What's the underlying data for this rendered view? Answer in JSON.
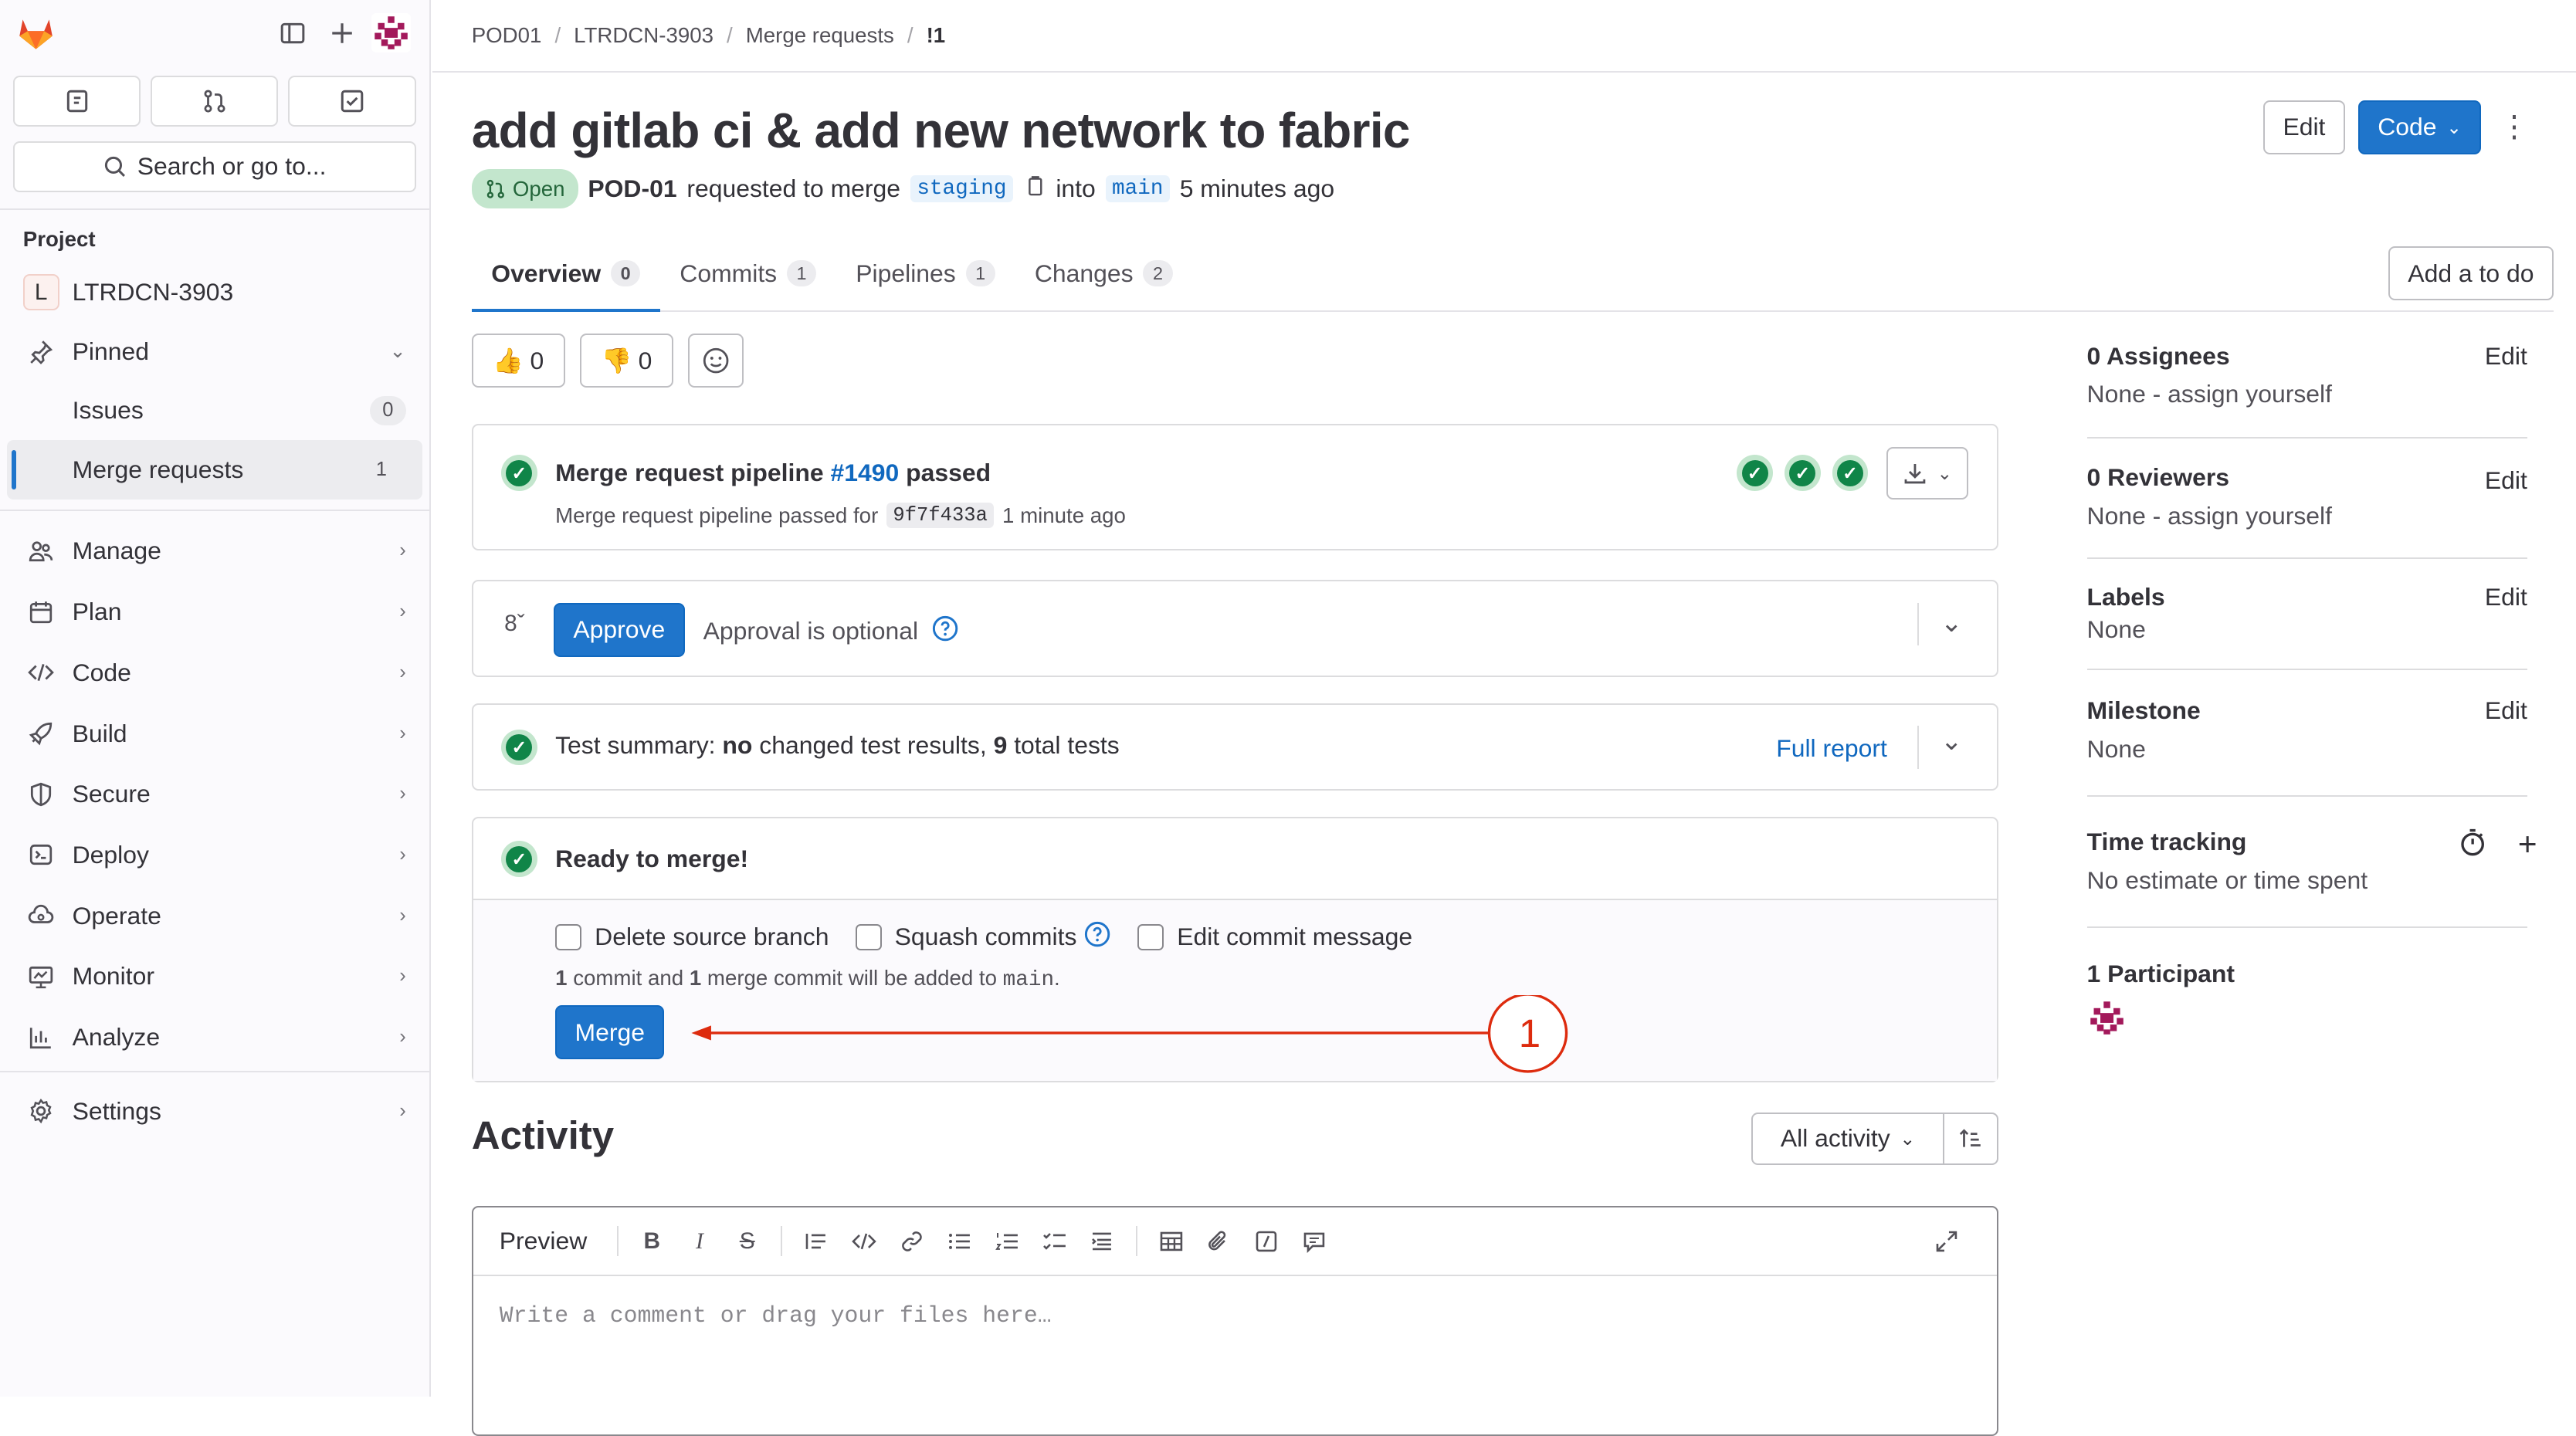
{
  "breadcrumbs": [
    "POD01",
    "LTRDCN-3903",
    "Merge requests",
    "!1"
  ],
  "sidebar": {
    "search_label": "Search or go to...",
    "section_title": "Project",
    "project": {
      "initial": "L",
      "name": "LTRDCN-3903"
    },
    "pinned_label": "Pinned",
    "pinned_items": [
      {
        "label": "Issues",
        "count": "0"
      },
      {
        "label": "Merge requests",
        "count": "1"
      }
    ],
    "nav": [
      "Manage",
      "Plan",
      "Code",
      "Build",
      "Secure",
      "Deploy",
      "Operate",
      "Monitor",
      "Analyze"
    ],
    "settings_label": "Settings"
  },
  "mr": {
    "title": "add gitlab ci & add new network to fabric",
    "status": "Open",
    "author": "POD-01",
    "requested_text": "requested to merge",
    "source_branch": "staging",
    "into_text": "into",
    "target_branch": "main",
    "time_ago": "5 minutes ago"
  },
  "header_buttons": {
    "edit": "Edit",
    "code": "Code"
  },
  "tabs": [
    {
      "label": "Overview",
      "count": "0"
    },
    {
      "label": "Commits",
      "count": "1"
    },
    {
      "label": "Pipelines",
      "count": "1"
    },
    {
      "label": "Changes",
      "count": "2"
    }
  ],
  "add_todo": "Add a to do",
  "reactions": {
    "thumbs_up": "0",
    "thumbs_down": "0"
  },
  "pipeline": {
    "prefix": "Merge request pipeline",
    "id": "#1490",
    "status": "passed",
    "sub_prefix": "Merge request pipeline passed for",
    "sha": "9f7f433a",
    "time": "1 minute ago"
  },
  "approval": {
    "button": "Approve",
    "text": "Approval is optional"
  },
  "test_summary": {
    "prefix": "Test summary:",
    "no": "no",
    "mid": "changed test results,",
    "count": "9",
    "suffix": "total tests",
    "report": "Full report"
  },
  "merge": {
    "ready": "Ready to merge!",
    "delete_branch": "Delete source branch",
    "squash": "Squash commits",
    "edit_msg": "Edit commit message",
    "commit_count": "1",
    "commit_text": "commit and",
    "merge_count": "1",
    "merge_text": "merge commit will be added to",
    "target": "main",
    "button": "Merge",
    "annotation": "1"
  },
  "activity": {
    "title": "Activity",
    "filter": "All activity"
  },
  "editor": {
    "preview": "Preview",
    "placeholder": "Write a comment or drag your files here…"
  },
  "right_sidebar": {
    "assignees": {
      "title": "0 Assignees",
      "value": "None - assign yourself",
      "edit": "Edit"
    },
    "reviewers": {
      "title": "0 Reviewers",
      "value": "None - assign yourself",
      "edit": "Edit"
    },
    "labels": {
      "title": "Labels",
      "value": "None",
      "edit": "Edit"
    },
    "milestone": {
      "title": "Milestone",
      "value": "None",
      "edit": "Edit"
    },
    "time_tracking": {
      "title": "Time tracking",
      "value": "No estimate or time spent"
    },
    "participants": {
      "title": "1 Participant"
    }
  },
  "colors": {
    "accent": "#1f75cb",
    "success": "#108548",
    "annotation": "#dd2b0e"
  }
}
